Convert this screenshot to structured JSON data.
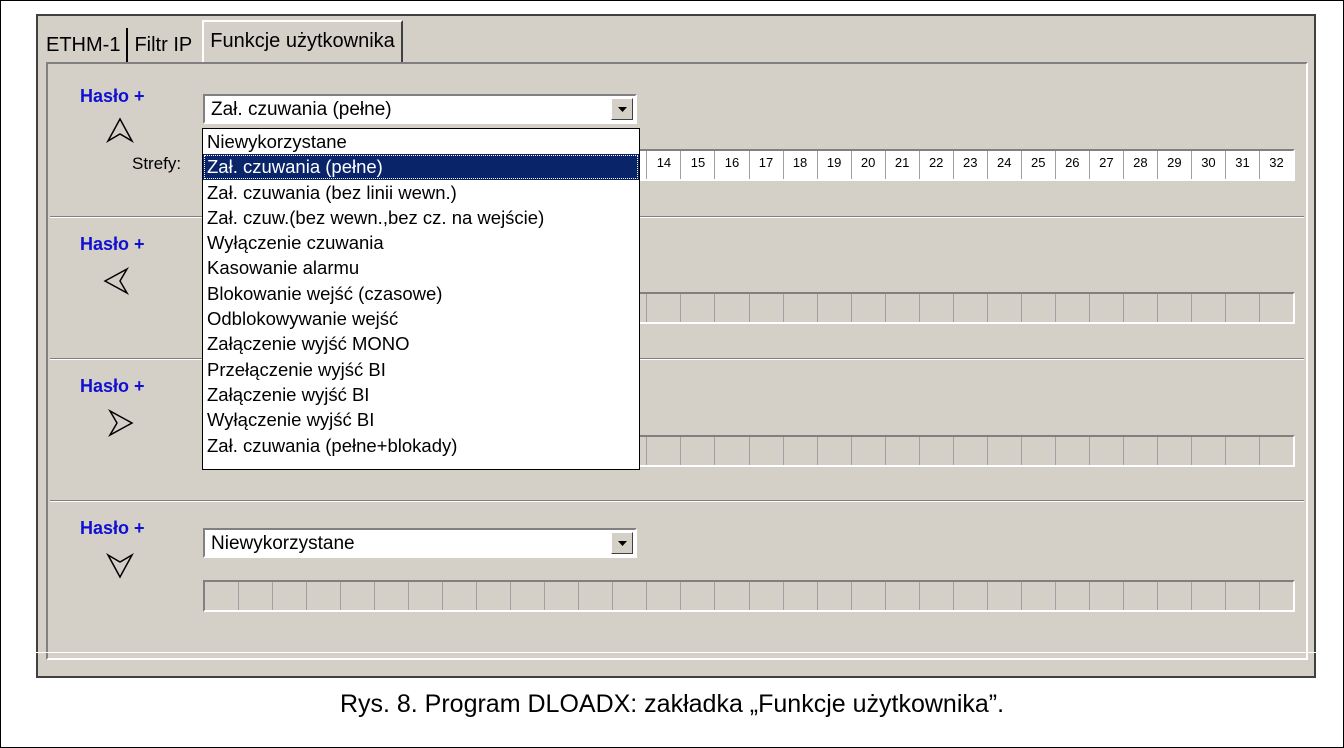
{
  "tabs": [
    {
      "label": "ETHM-1"
    },
    {
      "label": "Filtr IP"
    },
    {
      "label": "Funkcje użytkownika",
      "active": true
    }
  ],
  "sections": [
    {
      "label": "Hasło +",
      "arrow": "arrow-up-icon",
      "function": "Zał. czuwania (pełne)"
    },
    {
      "label": "Hasło +",
      "arrow": "arrow-left-icon",
      "function": ""
    },
    {
      "label": "Hasło +",
      "arrow": "arrow-right-icon",
      "function": ""
    },
    {
      "label": "Hasło +",
      "arrow": "arrow-down-icon",
      "function": "Niewykorzystane"
    }
  ],
  "strefy_label": "Strefy:",
  "zones": [
    "14",
    "15",
    "16",
    "17",
    "18",
    "19",
    "20",
    "21",
    "22",
    "23",
    "24",
    "25",
    "26",
    "27",
    "28",
    "29",
    "30",
    "31",
    "32"
  ],
  "dropdown": {
    "selected_index": 1,
    "options": [
      "Niewykorzystane",
      "Zał. czuwania (pełne)",
      "Zał. czuwania (bez linii wewn.)",
      "Zał. czuw.(bez wewn.,bez cz. na wejście)",
      "Wyłączenie czuwania",
      "Kasowanie alarmu",
      "Blokowanie wejść (czasowe)",
      "Odblokowywanie wejść",
      "Załączenie wyjść MONO",
      "Przełączenie wyjść BI",
      "Załączenie wyjść BI",
      "Wyłączenie wyjść BI",
      "Zał. czuwania (pełne+blokady)"
    ]
  },
  "caption": "Rys. 8. Program DLOADX: zakładka „Funkcje użytkownika”.",
  "colors": {
    "haslo": "#1010d0",
    "selection": "#0a246a",
    "window": "#d4d0c8"
  }
}
